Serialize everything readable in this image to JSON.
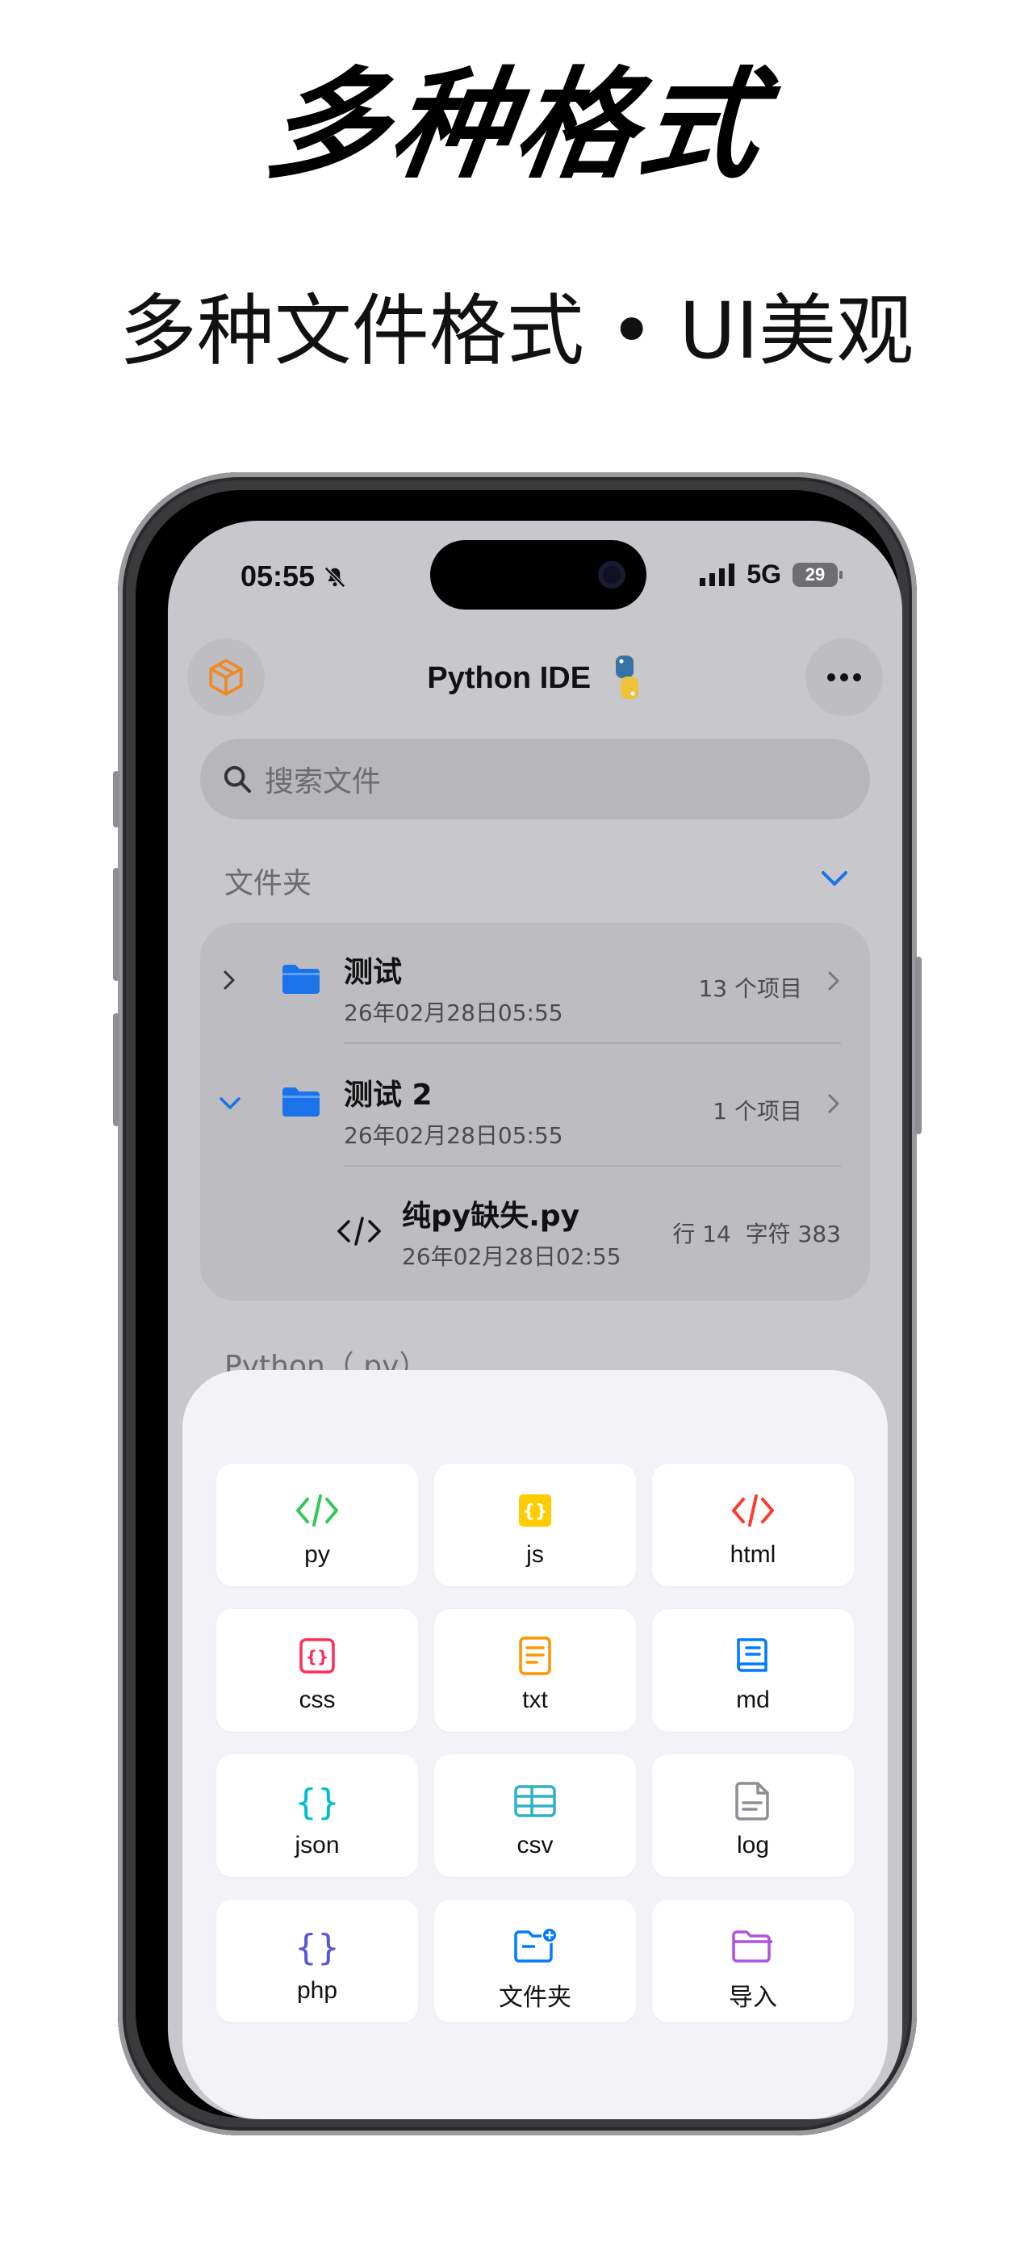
{
  "headline": "多种格式",
  "subhead": "多种文件格式 • UI美观",
  "status": {
    "time": "05:55",
    "network": "5G",
    "battery": "29"
  },
  "nav": {
    "title": "Python IDE"
  },
  "search": {
    "placeholder": "搜索文件"
  },
  "sections": {
    "folders": "文件夹",
    "python": "Python（.py）"
  },
  "folders": [
    {
      "name": "测试",
      "date": "26年02月28日05:55",
      "meta": "13 个项目"
    },
    {
      "name": "测试 2",
      "date": "26年02月28日05:55",
      "meta": "1 个项目"
    }
  ],
  "file": {
    "name": "纯py缺失.py",
    "date": "26年02月28日02:55",
    "meta": "行 14  字符 383"
  },
  "tiles": [
    {
      "label": "py",
      "icon": "code-icon",
      "color": "#34c759"
    },
    {
      "label": "js",
      "icon": "braces-badge-icon",
      "color": "#ffcc00"
    },
    {
      "label": "html",
      "icon": "code-icon",
      "color": "#ff3b30"
    },
    {
      "label": "css",
      "icon": "braces-square-icon",
      "color": "#ff2d55"
    },
    {
      "label": "txt",
      "icon": "document-text-icon",
      "color": "#ff9500"
    },
    {
      "label": "md",
      "icon": "book-icon",
      "color": "#007aff"
    },
    {
      "label": "json",
      "icon": "braces-icon",
      "color": "#00bcd4"
    },
    {
      "label": "csv",
      "icon": "table-icon",
      "color": "#30b0c7"
    },
    {
      "label": "log",
      "icon": "document-icon",
      "color": "#8e8e93"
    },
    {
      "label": "php",
      "icon": "braces-icon",
      "color": "#5856d6"
    },
    {
      "label": "文件夹",
      "icon": "folder-add-icon",
      "color": "#007aff"
    },
    {
      "label": "导入",
      "icon": "folder-icon",
      "color": "#af52de"
    }
  ]
}
